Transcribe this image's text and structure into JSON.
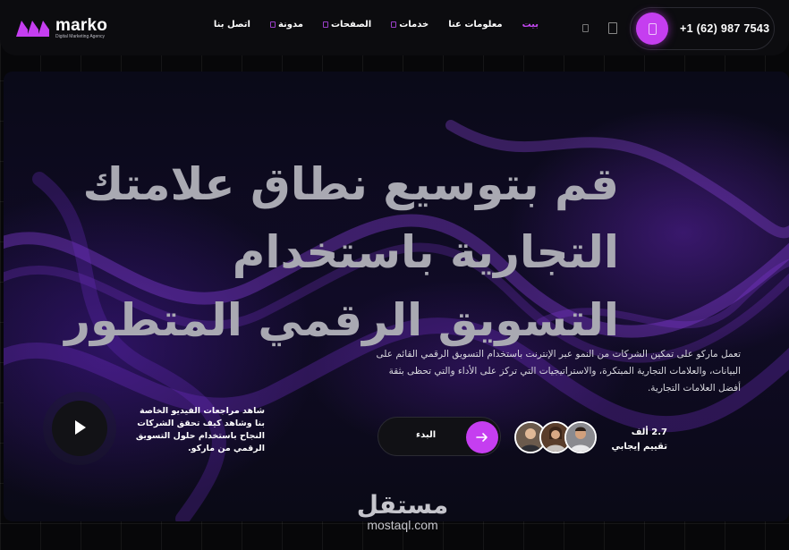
{
  "brand": {
    "name": "marko",
    "tagline": "Digital Marketing Agency",
    "accent_color": "#c53ef0"
  },
  "nav": {
    "items": [
      {
        "label": "بيت",
        "active": true,
        "has_dropdown": false
      },
      {
        "label": "معلومات عنا",
        "active": false,
        "has_dropdown": false
      },
      {
        "label": "خدمات",
        "active": false,
        "has_dropdown": true
      },
      {
        "label": "الصفحات",
        "active": false,
        "has_dropdown": true
      },
      {
        "label": "مدونة",
        "active": false,
        "has_dropdown": true
      },
      {
        "label": "اتصل بنا",
        "active": false,
        "has_dropdown": false
      }
    ]
  },
  "header": {
    "phone": "+1 (62) 987 7543",
    "phone_icon": "phone-icon",
    "search_icon": "search-icon",
    "menu_icon": "menu-icon"
  },
  "hero": {
    "headline": "قم بتوسيع نطاق علامتك التجارية باستخدام التسويق الرقمي المتطور",
    "description": "تعمل ماركو على تمكين الشركات من النمو عبر الإنترنت باستخدام التسويق الرقمي القائم على البيانات، والعلامات التجارية المبتكرة، والاستراتيجيات التي تركز على الأداء والتي تحظى بثقة أفضل العلامات التجارية.",
    "video_text": "شاهد مراجعات الفيديو الخاصة بنا وشاهد كيف تحقق الشركات النجاح باستخدام حلول التسويق الرقمي من ماركو.",
    "start_button": "البدء",
    "rating_text": "2.7 ألف تقييم إيجابي",
    "play_icon": "play-icon",
    "arrow_icon": "arrow-right-icon"
  },
  "watermark": {
    "arabic": "مستقل",
    "latin": "mostaql.com"
  }
}
